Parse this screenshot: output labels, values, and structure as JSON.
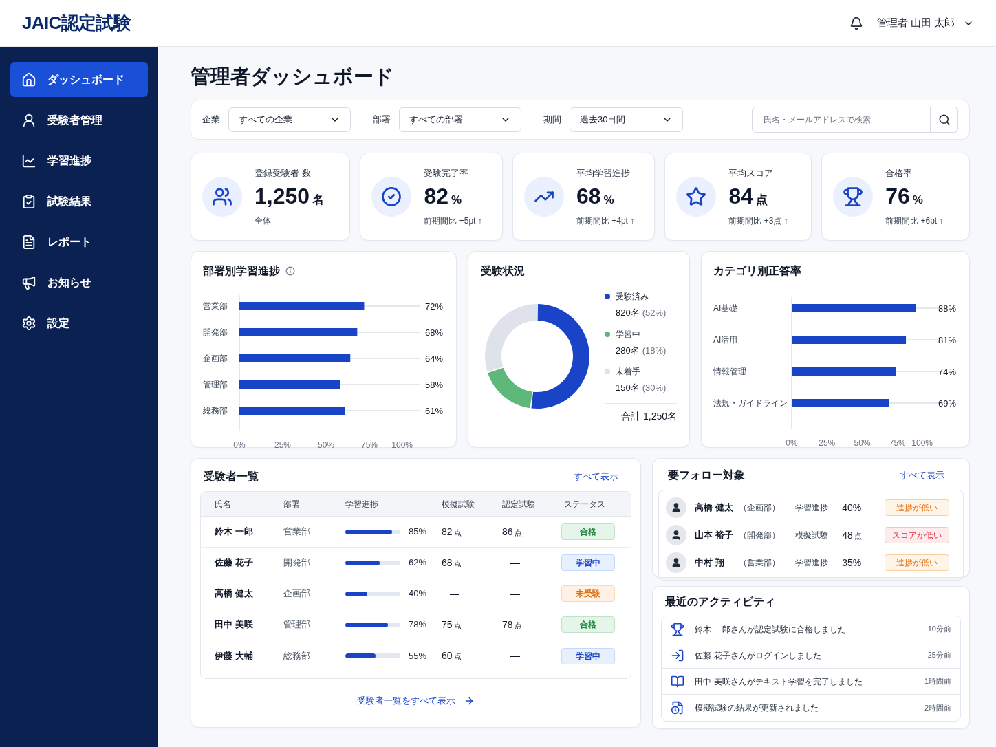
{
  "header": {
    "logo": "JAIC認定試験",
    "user": "管理者 山田 太郎"
  },
  "sidebar": {
    "items": [
      {
        "label": "ダッシュボード",
        "selected": true
      },
      {
        "label": "受験者管理",
        "selected": false
      },
      {
        "label": "学習進捗",
        "selected": false
      },
      {
        "label": "試験結果",
        "selected": false
      },
      {
        "label": "レポート",
        "selected": false
      },
      {
        "label": "お知らせ",
        "selected": false
      },
      {
        "label": "設定",
        "selected": false
      }
    ]
  },
  "page_title": "管理者ダッシュボード",
  "filters": [
    {
      "label": "企業",
      "value": "すべての企業"
    },
    {
      "label": "部署",
      "value": "すべての部署"
    },
    {
      "label": "期間",
      "value": "過去30日間"
    }
  ],
  "search": {
    "placeholder": "氏名・メールアドレスで検索"
  },
  "kpis": [
    {
      "label": "登録受験者 数",
      "value": "1,250",
      "unit": "名",
      "sub": "全体"
    },
    {
      "label": "受験完了率",
      "value": "82",
      "unit": "%",
      "sub": "前期間比 +5pt ↑"
    },
    {
      "label": "平均学習進捗",
      "value": "68",
      "unit": "%",
      "sub": "前期間比 +4pt ↑"
    },
    {
      "label": "平均スコア",
      "value": "84",
      "unit": "点",
      "sub": "前期間比 +3点 ↑"
    },
    {
      "label": "合格率",
      "value": "76",
      "unit": "%",
      "sub": "前期間比 +6pt ↑"
    }
  ],
  "dept_progress": {
    "title": "部署別学習進捗",
    "chart_data": {
      "type": "bar",
      "orientation": "horizontal",
      "categories": [
        "営業部",
        "開発部",
        "企画部",
        "管理部",
        "総務部"
      ],
      "values": [
        72,
        68,
        64,
        58,
        61
      ],
      "xlim": [
        0,
        100
      ],
      "xticks": [
        {
          "value": 0,
          "label": "0%"
        },
        {
          "value": 25,
          "label": "25%"
        },
        {
          "value": 50,
          "label": "50%"
        },
        {
          "value": 75,
          "label": "75%"
        },
        {
          "value": 100,
          "label": "100%"
        }
      ],
      "value_labels": [
        "72%",
        "68%",
        "64%",
        "58%",
        "61%"
      ]
    }
  },
  "exam_status": {
    "title": "受験状況",
    "chart_data": {
      "type": "donut",
      "categories": [
        "受験済み",
        "学習中",
        "未着手"
      ],
      "values": [
        52,
        18,
        30
      ]
    },
    "legend": [
      {
        "count": "820名",
        "share": "(52%)",
        "color": "#1a44c8"
      },
      {
        "count": "280名",
        "share": "(18%)",
        "color": "#5db87a"
      },
      {
        "count": "150名",
        "share": "(30%)",
        "color": "#dfe2ea"
      }
    ],
    "total": "合計 1,250名"
  },
  "category_accuracy": {
    "title": "カテゴリ別正答率",
    "chart_data": {
      "type": "bar",
      "orientation": "horizontal",
      "categories": [
        "AI基礎",
        "AI活用",
        "情報管理",
        "法規・ガイドライン"
      ],
      "values": [
        88,
        81,
        74,
        69
      ],
      "xlim": [
        0,
        100
      ],
      "xticks": [
        {
          "value": 0,
          "label": "0%"
        },
        {
          "value": 25,
          "label": "25%"
        },
        {
          "value": 50,
          "label": "50%"
        },
        {
          "value": 75,
          "label": "75%"
        },
        {
          "value": 100,
          "label": "100%"
        }
      ],
      "value_labels": [
        "88%",
        "81%",
        "74%",
        "69%"
      ]
    }
  },
  "candidates": {
    "title": "受験者一覧",
    "link": "すべて表示",
    "columns": [
      "氏名",
      "部署",
      "学習進捗",
      "模擬試験",
      "認定試験",
      "ステータス"
    ],
    "rows": [
      {
        "name": "鈴木 一郎",
        "dept": "営業部",
        "level": 0.85,
        "progress": "85%",
        "mock": {
          "value": "82",
          "unit": "点"
        },
        "cert": {
          "value": "86",
          "unit": "点"
        },
        "status": {
          "label": "合格",
          "kind": "pass"
        }
      },
      {
        "name": "佐藤 花子",
        "dept": "開発部",
        "level": 0.62,
        "progress": "62%",
        "mock": {
          "value": "68",
          "unit": "点"
        },
        "cert": {
          "value": "—"
        },
        "status": {
          "label": "学習中",
          "kind": "studying"
        }
      },
      {
        "name": "高橋 健太",
        "dept": "企画部",
        "level": 0.4,
        "progress": "40%",
        "mock": {
          "value": "—"
        },
        "cert": {
          "value": "—"
        },
        "status": {
          "label": "未受験",
          "kind": "untaken"
        }
      },
      {
        "name": "田中 美咲",
        "dept": "管理部",
        "level": 0.78,
        "progress": "78%",
        "mock": {
          "value": "75",
          "unit": "点"
        },
        "cert": {
          "value": "78",
          "unit": "点"
        },
        "status": {
          "label": "合格",
          "kind": "pass"
        }
      },
      {
        "name": "伊藤 大輔",
        "dept": "総務部",
        "level": 0.55,
        "progress": "55%",
        "mock": {
          "value": "60",
          "unit": "点"
        },
        "cert": {
          "value": "—"
        },
        "status": {
          "label": "学習中",
          "kind": "studying"
        }
      }
    ],
    "footer_link": "受験者一覧をすべて表示"
  },
  "follow_up": {
    "title": "要フォロー対象",
    "link": "すべて表示",
    "items": [
      {
        "name": "高橋 健太",
        "dept": "（企画部）",
        "metric": "学習進捗",
        "value": "40%",
        "tag": {
          "label": "進捗が低い",
          "kind": "progress"
        }
      },
      {
        "name": "山本 裕子",
        "dept": "（開発部）",
        "metric": "模擬試験",
        "value": "48",
        "unit": "点",
        "tag": {
          "label": "スコアが低い",
          "kind": "score"
        }
      },
      {
        "name": "中村 翔",
        "dept": "（営業部）",
        "metric": "学習進捗",
        "value": "35%",
        "tag": {
          "label": "進捗が低い",
          "kind": "progress"
        }
      }
    ]
  },
  "activity": {
    "title": "最近のアクティビティ",
    "items": [
      {
        "text": "鈴木 一郎さんが認定試験に合格しました",
        "time": "10分前"
      },
      {
        "text": "佐藤 花子さんがログインしました",
        "time": "25分前"
      },
      {
        "text": "田中 美咲さんがテキスト学習を完了しました",
        "time": "1時間前"
      },
      {
        "text": "模擬試験の結果が更新されました",
        "time": "2時間前"
      }
    ]
  }
}
